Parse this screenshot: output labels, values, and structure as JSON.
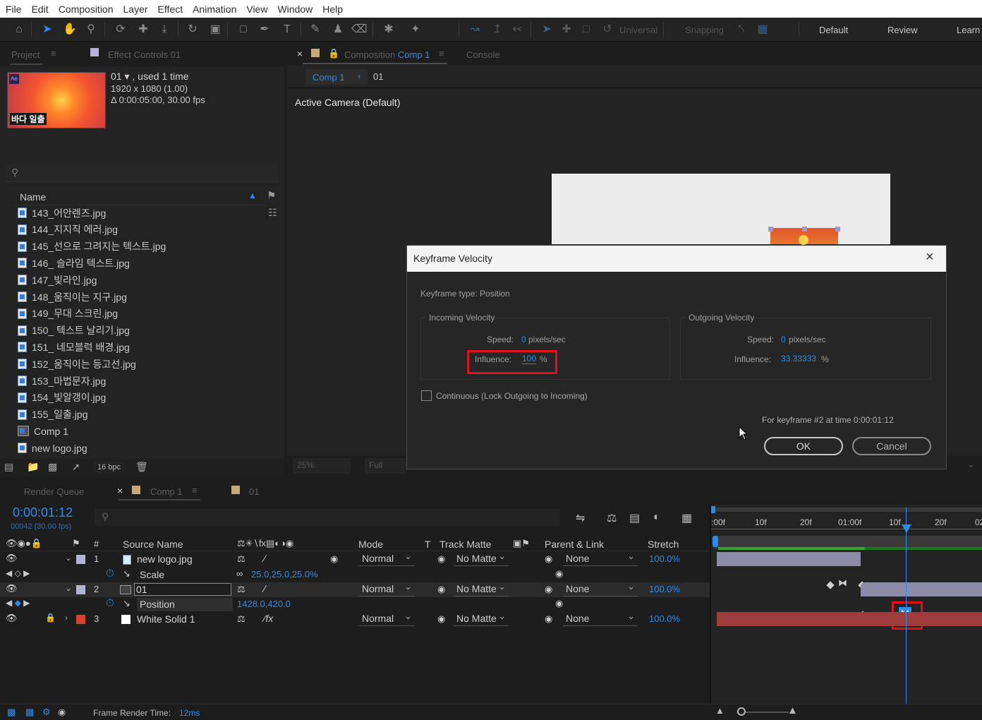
{
  "menu": [
    "File",
    "Edit",
    "Composition",
    "Layer",
    "Effect",
    "Animation",
    "View",
    "Window",
    "Help"
  ],
  "toolbar": {
    "universal_label": "Universal",
    "snapping_label": "Snapping",
    "workspaces": [
      "Default",
      "Review",
      "Learn"
    ]
  },
  "project_panel": {
    "tab_label": "Project",
    "effect_controls_tab": "Effect Controls 01",
    "item_name": "01 ▾ , used 1 time",
    "item_resolution": "1920 x 1080 (1.00)",
    "item_duration": "Δ 0:00:05:00, 30.00 fps",
    "thumb_caption": "바다 일출",
    "column_name": "Name",
    "files": [
      "143_어안렌즈.jpg",
      "144_지지직 에러.jpg",
      "145_선으로 그려지는 텍스트.jpg",
      "146_ 슬라임 텍스트.jpg",
      "147_빛라인.jpg",
      "148_움직이는 지구.jpg",
      "149_무대 스크린.jpg",
      "150_ 텍스트 날리기.jpg",
      "151_ 네모블럭 배경.jpg",
      "152_움직이는 등고선.jpg",
      "153_마법문자.jpg",
      "154_빛알갱이.jpg",
      "155_일출.jpg"
    ],
    "comp_item": "Comp 1",
    "logo_item": "new logo.jpg",
    "bpc": "16 bpc"
  },
  "comp_panel": {
    "tab_prefix": "Composition",
    "tab_comp": "Comp 1",
    "console_tab": "Console",
    "breadcrumb_comp": "Comp 1",
    "breadcrumb_layer": "01",
    "camera_label": "Active Camera (Default)",
    "zoom": "25%",
    "resolution": "Full"
  },
  "dialog": {
    "title": "Keyframe Velocity",
    "keyframe_type": "Keyframe type: Position",
    "incoming_title": "Incoming Velocity",
    "outgoing_title": "Outgoing Velocity",
    "speed_label": "Speed:",
    "influence_label": "Influence:",
    "incoming_speed": "0",
    "incoming_influence": "100",
    "outgoing_speed": "0",
    "outgoing_influence": "33.33333",
    "speed_unit": "pixels/sec",
    "percent": "%",
    "continuous_label": "Continuous (Lock Outgoing to Incoming)",
    "keyframe_info": "For keyframe #2 at time 0:00:01:12",
    "ok_label": "OK",
    "cancel_label": "Cancel"
  },
  "timeline": {
    "render_queue_tab": "Render Queue",
    "comp_tab": "Comp 1",
    "layer_tab": "01",
    "timecode": "0:00:01:12",
    "frame_info": "00042 (30.00 fps)",
    "columns": {
      "num": "#",
      "source": "Source Name",
      "mode": "Mode",
      "t": "T",
      "track_matte": "Track Matte",
      "parent": "Parent & Link",
      "stretch": "Stretch"
    },
    "ruler": [
      ":00f",
      "10f",
      "20f",
      "01:00f",
      "10f",
      "20f",
      "02"
    ],
    "layers": [
      {
        "num": "1",
        "name": "new logo.jpg",
        "mode": "Normal",
        "matte": "No Matte",
        "parent": "None",
        "stretch": "100.0%"
      },
      {
        "num": "2",
        "name": "01",
        "mode": "Normal",
        "matte": "No Matte",
        "parent": "None",
        "stretch": "100.0%"
      },
      {
        "num": "3",
        "name": "White Solid 1",
        "mode": "Normal",
        "matte": "No Matte",
        "parent": "None",
        "stretch": "100.0%"
      }
    ],
    "scale_label": "Scale",
    "scale_value": "25.0,25.0,25.0%",
    "position_label": "Position",
    "position_value": "1428.0,420.0",
    "footer_label": "Frame Render Time:",
    "footer_value": "12ms"
  },
  "colors": {
    "accent": "#2d8ceb",
    "highlight_box": "#e2101a",
    "layer1_label": "#b3b3d6",
    "layer3_label": "#d9422e",
    "solid_bar": "#a13c3c",
    "layer_bar": "#8c8ca8"
  }
}
